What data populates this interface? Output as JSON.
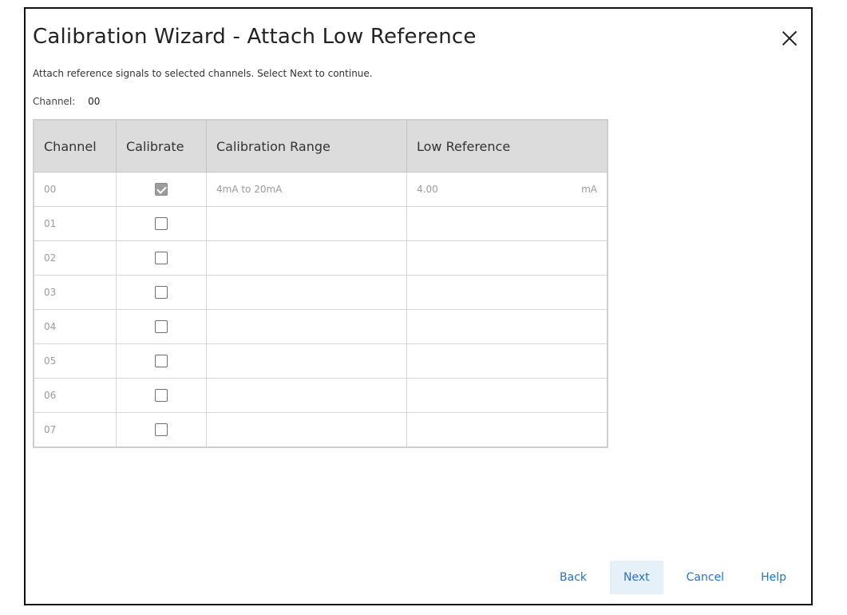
{
  "dialog": {
    "title": "Calibration Wizard -  Attach Low Reference",
    "instruction": "Attach reference signals to selected channels. Select Next to continue.",
    "channel_label": "Channel:",
    "channel_value": "00"
  },
  "table": {
    "headers": [
      "Channel",
      "Calibrate",
      "Calibration Range",
      "Low Reference"
    ],
    "rows": [
      {
        "channel": "00",
        "checked": true,
        "range": "4mA to 20mA",
        "low_ref": "4.00",
        "unit": "mA"
      },
      {
        "channel": "01",
        "checked": false,
        "range": "",
        "low_ref": "",
        "unit": ""
      },
      {
        "channel": "02",
        "checked": false,
        "range": "",
        "low_ref": "",
        "unit": ""
      },
      {
        "channel": "03",
        "checked": false,
        "range": "",
        "low_ref": "",
        "unit": ""
      },
      {
        "channel": "04",
        "checked": false,
        "range": "",
        "low_ref": "",
        "unit": ""
      },
      {
        "channel": "05",
        "checked": false,
        "range": "",
        "low_ref": "",
        "unit": ""
      },
      {
        "channel": "06",
        "checked": false,
        "range": "",
        "low_ref": "",
        "unit": ""
      },
      {
        "channel": "07",
        "checked": false,
        "range": "",
        "low_ref": "",
        "unit": ""
      }
    ]
  },
  "footer": {
    "back": "Back",
    "next": "Next",
    "cancel": "Cancel",
    "help": "Help"
  },
  "colors": {
    "accent": "#2a72c0",
    "header_bg": "#dcdcdc",
    "primary_button_bg": "#e6f0f9"
  },
  "icons": {
    "close": "close-icon",
    "checkbox": "checkbox-icon"
  }
}
